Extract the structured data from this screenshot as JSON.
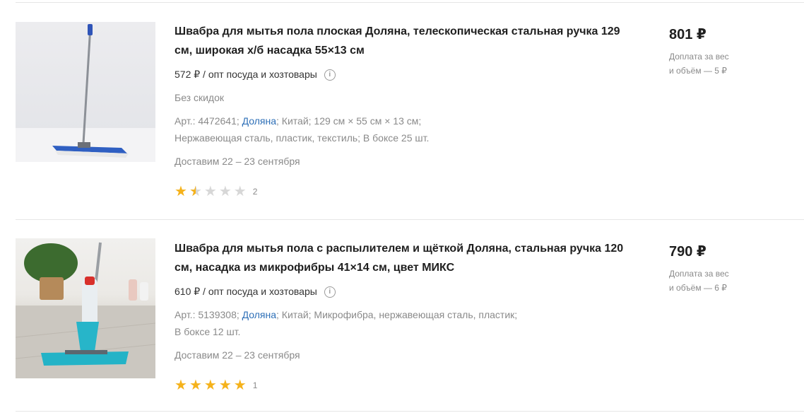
{
  "products": [
    {
      "title": "Швабра для мытья пола плоская Доляна, телескопическая стальная ручка 129 см, широкая х/б насадка 55×13 см",
      "wholesale_price": "572 ₽ / опт посуда и хозтовары",
      "discount": "Без скидок",
      "meta_line1": {
        "art": "Арт.: 4472641;",
        "brand": "Доляна",
        "rest": "; Китай; 129 см × 55 см × 13 см;"
      },
      "meta_line2": "Нержавеющая сталь, пластик, текстиль; В боксе 25 шт.",
      "delivery": "Доставим 22 – 23 сентября",
      "rating": 1.5,
      "reviews": "2",
      "price": "801 ₽",
      "extra_line1": "Доплата за вес",
      "extra_line2": "и объём — 5 ₽",
      "image_icon": "flat-mop-image"
    },
    {
      "title": "Швабра для мытья пола с распылителем и щёткой Доляна, стальная ручка 120 см, насадка из микрофибры 41×14 см, цвет МИКС",
      "wholesale_price": "610 ₽ / опт посуда и хозтовары",
      "meta_line1": {
        "art": "Арт.: 5139308;",
        "brand": "Доляна",
        "rest": "; Китай; Микрофибра, нержавеющая сталь, пластик;"
      },
      "meta_line2": "В боксе 12 шт.",
      "delivery": "Доставим 22 – 23 сентября",
      "rating": 5,
      "reviews": "1",
      "price": "790 ₽",
      "extra_line1": "Доплата за вес",
      "extra_line2": "и объём — 6 ₽",
      "image_icon": "spray-mop-image"
    }
  ],
  "colors": {
    "brand_link": "#2d6fb7",
    "star": "#f5b21b",
    "star_empty": "#d7d7d7",
    "muted": "#8a8a8a"
  }
}
